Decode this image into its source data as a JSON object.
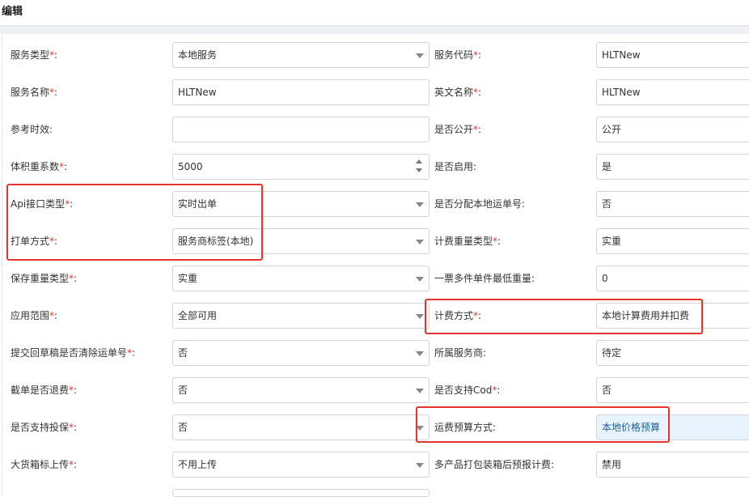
{
  "page": {
    "title": "编辑"
  },
  "rows": [
    {
      "left": {
        "label": "服务类型",
        "required": "*",
        "value": "本地服务",
        "type": "select"
      },
      "right": {
        "label": "服务代码",
        "required": "*",
        "value": "HLTNew",
        "type": "text"
      }
    },
    {
      "left": {
        "label": "服务名称",
        "required": "*",
        "value": "HLTNew",
        "type": "text"
      },
      "right": {
        "label": "英文名称",
        "required": "*",
        "value": "HLTNew",
        "type": "text"
      }
    },
    {
      "left": {
        "label": "参考时效",
        "required": "",
        "value": "",
        "type": "text"
      },
      "right": {
        "label": "是否公开",
        "required": "*",
        "value": "公开",
        "type": "text"
      }
    },
    {
      "left": {
        "label": "体积重系数",
        "required": "*",
        "value": "5000",
        "type": "number"
      },
      "right": {
        "label": "是否启用",
        "required": "",
        "value": "是",
        "type": "text"
      }
    },
    {
      "left": {
        "label": "Api接口类型",
        "required": "*",
        "value": "实时出单",
        "type": "select"
      },
      "right": {
        "label": "是否分配本地运单号",
        "required": "",
        "value": "否",
        "type": "text"
      }
    },
    {
      "left": {
        "label": "打单方式",
        "required": "*",
        "value": "服务商标签(本地)",
        "type": "select"
      },
      "right": {
        "label": "计费重量类型",
        "required": "*",
        "value": "实重",
        "type": "text"
      }
    },
    {
      "left": {
        "label": "保存重量类型",
        "required": "*",
        "value": "实重",
        "type": "select"
      },
      "right": {
        "label": "一票多件单件最低重量",
        "required": "",
        "value": "0",
        "type": "text"
      }
    },
    {
      "left": {
        "label": "应用范围",
        "required": "*",
        "value": "全部可用",
        "type": "select"
      },
      "right": {
        "label": "计费方式",
        "required": "*",
        "value": "本地计算费用并扣费",
        "type": "text"
      }
    },
    {
      "left": {
        "label": "提交回草稿是否清除运单号",
        "required": "*",
        "value": "否",
        "type": "select"
      },
      "right": {
        "label": "所属服务商",
        "required": "",
        "value": "待定",
        "type": "text"
      }
    },
    {
      "left": {
        "label": "截单是否退费",
        "required": "*",
        "value": "否",
        "type": "select"
      },
      "right": {
        "label": "是否支持Cod",
        "required": "*",
        "value": "否",
        "type": "text"
      }
    },
    {
      "left": {
        "label": "是否支持投保",
        "required": "*",
        "value": "否",
        "type": "select"
      },
      "right": {
        "label": "运费预算方式",
        "required": "",
        "value": "本地价格预算",
        "type": "text"
      }
    },
    {
      "left": {
        "label": "大货箱标上传",
        "required": "*",
        "value": "不用上传",
        "type": "select"
      },
      "right": {
        "label": "多产品打包装箱后预报计费",
        "required": "",
        "value": "禁用",
        "type": "text"
      }
    }
  ],
  "colon": ":",
  "colors": {
    "required": "#e5352e",
    "highlight_border": "#e5352e",
    "highlight_fill": "#e9f3fd"
  }
}
